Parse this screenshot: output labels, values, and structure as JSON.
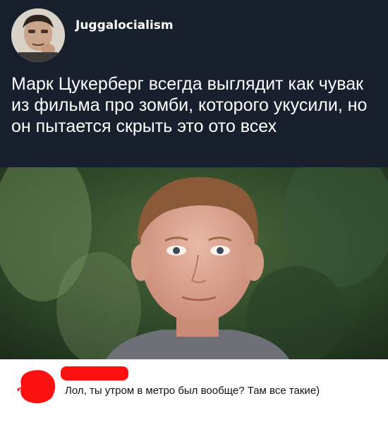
{
  "post": {
    "username": "Juggalocialism",
    "text": "Марк Цукерберг всегда выглядит как чувак из фильма про зомби, которого укусили, но он пытается скрыть это ото всех"
  },
  "photo": {
    "subject": "portrait-photo"
  },
  "comment": {
    "text": "Лол, ты утром в метро был вообще? Там все такие)",
    "redaction_color": "#ff1010"
  },
  "colors": {
    "post_background": "#17202c",
    "text": "#ffffff"
  }
}
